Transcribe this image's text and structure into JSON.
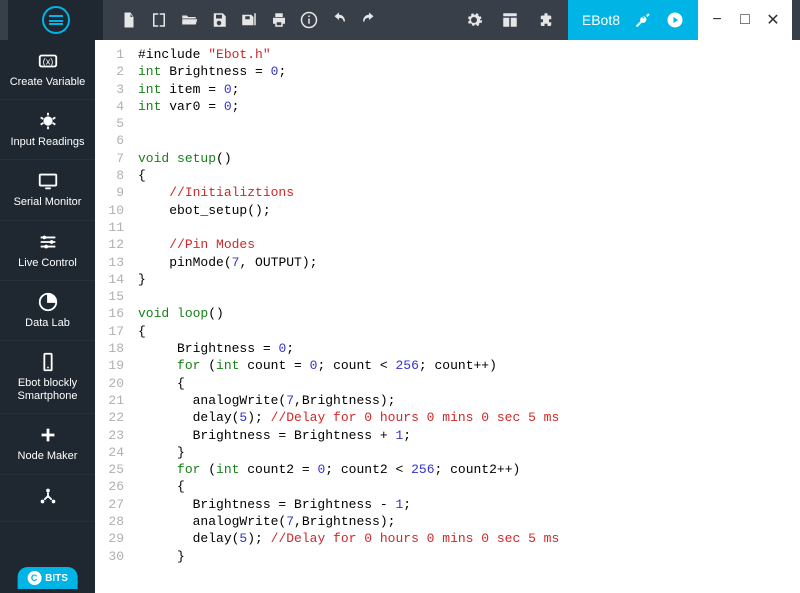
{
  "tab": {
    "label": "EBot8"
  },
  "sidebar": {
    "items": [
      {
        "label": "Create Variable"
      },
      {
        "label": "Input Readings"
      },
      {
        "label": "Serial Monitor"
      },
      {
        "label": "Live Control"
      },
      {
        "label": "Data Lab"
      },
      {
        "label": "Ebot blockly Smartphone"
      },
      {
        "label": "Node Maker"
      },
      {
        "label": ""
      }
    ]
  },
  "bits": "BITS",
  "code": {
    "lines": [
      [
        [
          "p",
          "#include "
        ],
        [
          "s",
          "\"Ebot.h\""
        ]
      ],
      [
        [
          "k",
          "int"
        ],
        [
          "p",
          " Brightness = "
        ],
        [
          "n",
          "0"
        ],
        [
          "p",
          ";"
        ]
      ],
      [
        [
          "k",
          "int"
        ],
        [
          "p",
          " item = "
        ],
        [
          "n",
          "0"
        ],
        [
          "p",
          ";"
        ]
      ],
      [
        [
          "k",
          "int"
        ],
        [
          "p",
          " var0 = "
        ],
        [
          "n",
          "0"
        ],
        [
          "p",
          ";"
        ]
      ],
      [],
      [],
      [
        [
          "k",
          "void"
        ],
        [
          "p",
          " "
        ],
        [
          "k",
          "setup"
        ],
        [
          "p",
          "()"
        ]
      ],
      [
        [
          "p",
          "{"
        ]
      ],
      [
        [
          "p",
          "    "
        ],
        [
          "c",
          "//Initializtions"
        ]
      ],
      [
        [
          "p",
          "    ebot_setup();"
        ]
      ],
      [],
      [
        [
          "p",
          "    "
        ],
        [
          "c",
          "//Pin Modes"
        ]
      ],
      [
        [
          "p",
          "    pinMode("
        ],
        [
          "n",
          "7"
        ],
        [
          "p",
          ", OUTPUT);"
        ]
      ],
      [
        [
          "p",
          "}"
        ]
      ],
      [],
      [
        [
          "k",
          "void"
        ],
        [
          "p",
          " "
        ],
        [
          "k",
          "loop"
        ],
        [
          "p",
          "()"
        ]
      ],
      [
        [
          "p",
          "{"
        ]
      ],
      [
        [
          "p",
          "     Brightness = "
        ],
        [
          "n",
          "0"
        ],
        [
          "p",
          ";"
        ]
      ],
      [
        [
          "p",
          "     "
        ],
        [
          "k",
          "for"
        ],
        [
          "p",
          " ("
        ],
        [
          "k",
          "int"
        ],
        [
          "p",
          " count = "
        ],
        [
          "n",
          "0"
        ],
        [
          "p",
          "; count < "
        ],
        [
          "n",
          "256"
        ],
        [
          "p",
          "; count++)"
        ]
      ],
      [
        [
          "p",
          "     {"
        ]
      ],
      [
        [
          "p",
          "       analogWrite("
        ],
        [
          "n",
          "7"
        ],
        [
          "p",
          ",Brightness);"
        ]
      ],
      [
        [
          "p",
          "       delay("
        ],
        [
          "n",
          "5"
        ],
        [
          "p",
          "); "
        ],
        [
          "c",
          "//Delay for 0 hours 0 mins 0 sec 5 ms"
        ]
      ],
      [
        [
          "p",
          "       Brightness = Brightness + "
        ],
        [
          "n",
          "1"
        ],
        [
          "p",
          ";"
        ]
      ],
      [
        [
          "p",
          "     }"
        ]
      ],
      [
        [
          "p",
          "     "
        ],
        [
          "k",
          "for"
        ],
        [
          "p",
          " ("
        ],
        [
          "k",
          "int"
        ],
        [
          "p",
          " count2 = "
        ],
        [
          "n",
          "0"
        ],
        [
          "p",
          "; count2 < "
        ],
        [
          "n",
          "256"
        ],
        [
          "p",
          "; count2++)"
        ]
      ],
      [
        [
          "p",
          "     {"
        ]
      ],
      [
        [
          "p",
          "       Brightness = Brightness - "
        ],
        [
          "n",
          "1"
        ],
        [
          "p",
          ";"
        ]
      ],
      [
        [
          "p",
          "       analogWrite("
        ],
        [
          "n",
          "7"
        ],
        [
          "p",
          ",Brightness);"
        ]
      ],
      [
        [
          "p",
          "       delay("
        ],
        [
          "n",
          "5"
        ],
        [
          "p",
          "); "
        ],
        [
          "c",
          "//Delay for 0 hours 0 mins 0 sec 5 ms"
        ]
      ],
      [
        [
          "p",
          "     }"
        ]
      ]
    ],
    "start_line": 1
  }
}
